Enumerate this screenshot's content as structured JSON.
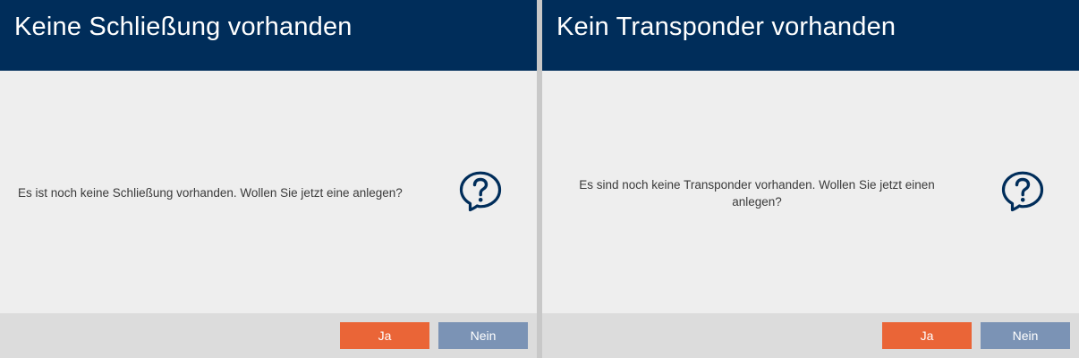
{
  "colors": {
    "header_bg": "#002d5a",
    "body_bg": "#eeeeee",
    "footer_bg": "#dcdcdc",
    "yes_button": "#ea6537",
    "no_button": "#7b93b5",
    "icon": "#002d5a"
  },
  "dialogs": [
    {
      "title": "Keine Schließung vorhanden",
      "message": "Es ist noch keine Schließung vorhanden. Wollen Sie jetzt eine anlegen?",
      "icon": "question-bubble-icon",
      "yes_label": "Ja",
      "no_label": "Nein"
    },
    {
      "title": "Kein Transponder vorhanden",
      "message": "Es sind noch keine Transponder vorhanden. Wollen Sie jetzt einen anlegen?",
      "icon": "question-bubble-icon",
      "yes_label": "Ja",
      "no_label": "Nein"
    }
  ]
}
